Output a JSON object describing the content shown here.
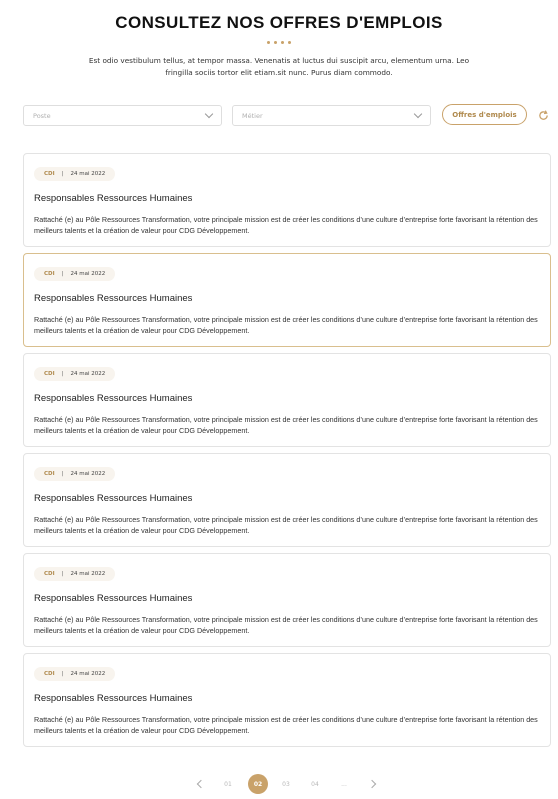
{
  "header": {
    "title": "CONSULTEZ NOS OFFRES D'EMPLOIS",
    "intro": "Est odio vestibulum tellus, at tempor massa. Venenatis at luctus dui suscipit arcu, elementum urna. Leo fringilla sociis tortor elit etiam.sit nunc. Purus diam commodo."
  },
  "filters": {
    "poste_placeholder": "Poste",
    "metier_placeholder": "Métier",
    "offers_button": "Offres d'emplois"
  },
  "jobs": [
    {
      "type": "CDI",
      "sep": "|",
      "date": "24 mai 2022",
      "title": "Responsables Ressources Humaines",
      "description": "Rattaché (e) au Pôle Ressources Transformation, votre principale mission est de créer les conditions d’une culture d’entreprise forte favorisant la rétention des meilleurs talents et la création de valeur pour CDG Développement."
    },
    {
      "type": "CDI",
      "sep": "|",
      "date": "24 mai 2022",
      "title": "Responsables Ressources Humaines",
      "description": "Rattaché (e) au Pôle Ressources Transformation, votre principale mission est de créer les conditions d’une culture d’entreprise forte favorisant la rétention des meilleurs talents et la création de valeur pour CDG Développement."
    },
    {
      "type": "CDI",
      "sep": "|",
      "date": "24 mai 2022",
      "title": "Responsables Ressources Humaines",
      "description": "Rattaché (e) au Pôle Ressources Transformation, votre principale mission est de créer les conditions d’une culture d’entreprise forte favorisant la rétention des meilleurs talents et la création de valeur pour CDG Développement."
    },
    {
      "type": "CDI",
      "sep": "|",
      "date": "24 mai 2022",
      "title": "Responsables Ressources Humaines",
      "description": "Rattaché (e) au Pôle Ressources Transformation, votre principale mission est de créer les conditions d’une culture d’entreprise forte favorisant la rétention des meilleurs talents et la création de valeur pour CDG Développement."
    },
    {
      "type": "CDI",
      "sep": "|",
      "date": "24 mai 2022",
      "title": "Responsables Ressources Humaines",
      "description": "Rattaché (e) au Pôle Ressources Transformation, votre principale mission est de créer les conditions d’une culture d’entreprise forte favorisant la rétention des meilleurs talents et la création de valeur pour CDG Développement."
    },
    {
      "type": "CDI",
      "sep": "|",
      "date": "24 mai 2022",
      "title": "Responsables Ressources Humaines",
      "description": "Rattaché (e) au Pôle Ressources Transformation, votre principale mission est de créer les conditions d’une culture d’entreprise forte favorisant la rétention des meilleurs talents et la création de valeur pour CDG Développement."
    }
  ],
  "active_job": 2,
  "pagination": {
    "pages": [
      "01",
      "02",
      "03",
      "04",
      "..."
    ],
    "current": "02"
  },
  "colors": {
    "accent": "#c9a26a",
    "accent_text": "#b08a4e",
    "badge_bg": "#f8f4ee",
    "border": "#e3e3e3"
  },
  "icons": {
    "prev": "chevron-left-icon",
    "next": "chevron-right-icon",
    "refresh": "refresh-icon",
    "dropdown": "chevron-down-icon"
  }
}
